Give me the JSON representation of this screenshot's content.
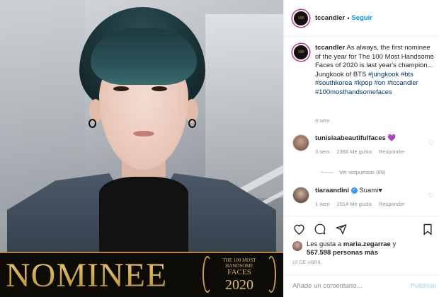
{
  "post_image": {
    "banner_word": "NOMINEE",
    "badge": {
      "line1": "THE 100 MOST",
      "line1b": "HANDSOME",
      "line2": "FACES",
      "line3": "2020"
    }
  },
  "header": {
    "username": "tccandler",
    "separator": "•",
    "follow_label": "Seguir"
  },
  "avatar_text": "100",
  "caption": {
    "username": "tccandler",
    "text": "As always, the first nominee of the year for The 100 Most Handsome Faces of 2020 is last year's champion... Jungkook of BTS",
    "hashtags": [
      "#jungkook",
      "#bts",
      "#southkorea",
      "#kpop",
      "#on",
      "#tccandler",
      "#100mosthandsomefaces"
    ],
    "time": "3 sem"
  },
  "comments": [
    {
      "username": "tunisiaabeautifulfaces",
      "text": "",
      "emoji": "💜",
      "time": "3 sem",
      "likes": "2368 Me gusta",
      "reply": "Responder",
      "view_replies": "Ver respuestas (89)"
    },
    {
      "username": "tiaraandini",
      "text": "Suami♥",
      "verified": "✓",
      "time": "1 sem",
      "likes": "2014 Me gusta",
      "reply": "Responder"
    }
  ],
  "likes_summary": {
    "prefix": "Les gusta a",
    "user": "maria.zegarrae",
    "conjunction": "y",
    "count": "567.598 personas más"
  },
  "date": "10 DE ABRIL",
  "comment_input": {
    "placeholder": "Añade un comentario...",
    "publish_label": "Publicar"
  },
  "icons": [
    "heart-icon",
    "comment-icon",
    "share-icon",
    "bookmark-icon"
  ],
  "colors": {
    "follow": "#0095f6",
    "hashtag": "#00376b",
    "gold": "#d6ad52"
  }
}
